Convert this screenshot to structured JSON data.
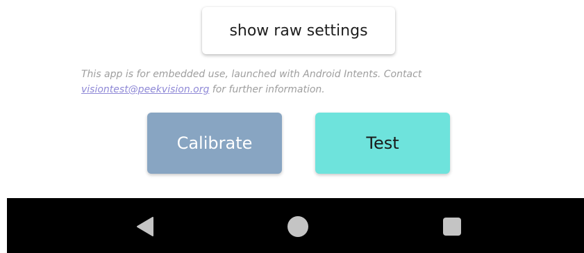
{
  "raw_settings_button": {
    "label": "show raw settings"
  },
  "info": {
    "text_before": "This app is for embedded use, launched with Android Intents. Contact ",
    "email": "visiontest@peekvision.org",
    "text_after": " for further information."
  },
  "actions": {
    "calibrate_label": "Calibrate",
    "test_label": "Test"
  },
  "colors": {
    "calibrate_bg": "#88a5c2",
    "test_bg": "#6ee3dc",
    "link": "#8e88d6",
    "navbar_bg": "#000000",
    "nav_icon": "#c4c4c4"
  },
  "navbar": {
    "icons": [
      "back-icon",
      "home-icon",
      "recent-apps-icon"
    ]
  }
}
